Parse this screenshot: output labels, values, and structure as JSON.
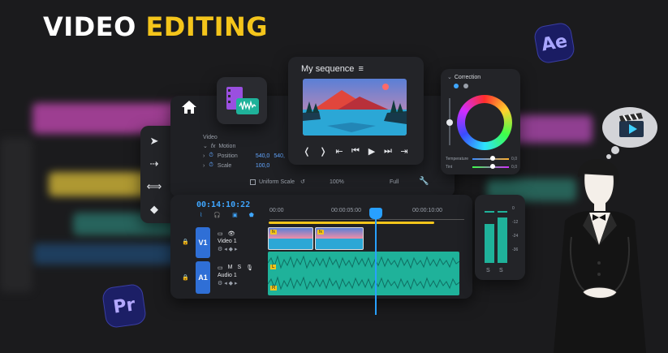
{
  "banner": {
    "word1": "VIDEO",
    "word2": "EDITING"
  },
  "apps": {
    "ae": "Ae",
    "pr": "Pr"
  },
  "sequence": {
    "title": "My sequence",
    "menu_icon": "≡",
    "transport": [
      "❬",
      "❭",
      "⇤",
      "⏮",
      "▶",
      "⏭",
      "⇥"
    ]
  },
  "effects": {
    "video": "Video",
    "fx": "fx",
    "motion": "Motion",
    "position_label": "Position",
    "position_x": "540,0",
    "position_y": "540,",
    "scale_label": "Scale",
    "scale_value": "100,0",
    "uniform_scale": "Uniform Scale",
    "zoom": "100%",
    "full": "Full"
  },
  "correction": {
    "title": "Correction",
    "temperature_label": "Temperature",
    "temperature_value": "0,0",
    "tint_label": "Tint",
    "tint_value": "0,0"
  },
  "timeline": {
    "timecode": "00:14:10:22",
    "ruler": [
      "00:00",
      "00:00:05:00",
      "00:00:10:00"
    ],
    "video_track": {
      "label": "V1",
      "name": "Video 1"
    },
    "audio_track": {
      "label": "A1",
      "name": "Audio 1",
      "m": "M",
      "s": "S"
    },
    "clip_badge": "fx",
    "audio_l": "L",
    "audio_r": "R"
  },
  "meter": {
    "scale": [
      "0",
      "-12",
      "-24",
      "-36"
    ],
    "left_label": "S",
    "right_label": "S"
  },
  "colors": {
    "accent_yellow": "#f4c51b",
    "track_blue": "#2f6fd6",
    "audio_green": "#1fb29a",
    "playhead": "#28a0ff"
  }
}
